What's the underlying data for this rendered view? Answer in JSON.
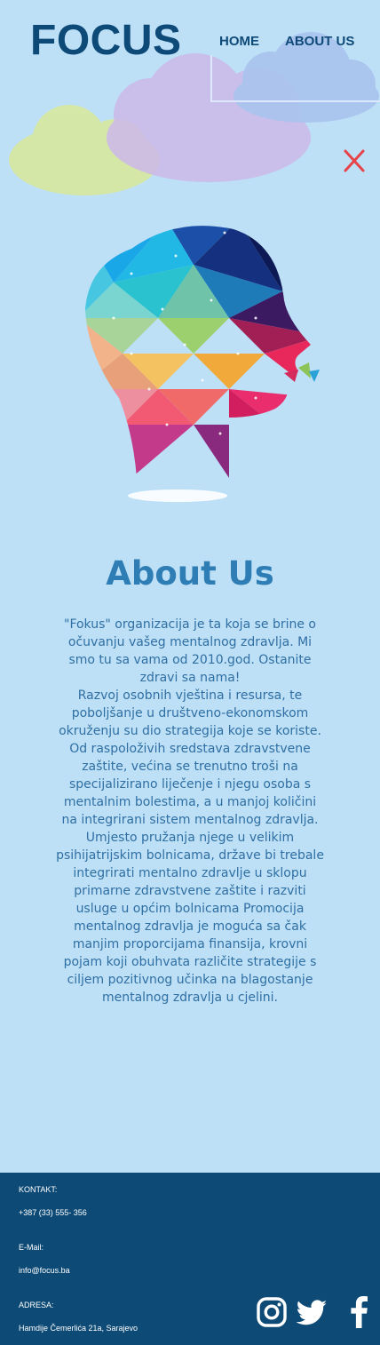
{
  "header": {
    "logo": "FOCUS",
    "nav": [
      {
        "label": "HOME"
      },
      {
        "label": "ABOUT US"
      }
    ],
    "close_icon": "close-icon"
  },
  "about": {
    "title": "About Us",
    "paragraphs": [
      "\"Fokus\" organizacija je ta koja se brine o očuvanju vašeg mentalnog zdravlja. Mi smo tu sa vama od 2010.god. Ostanite zdravi sa nama!",
      "Razvoj osobnih vještina i resursa, te poboljšanje u društveno-ekonomskom okruženju su dio strategija koje se koriste. Od raspoloživih sredstava zdravstvene zaštite, većina se trenutno troši na specijalizirano liječenje i njegu osoba s mentalnim bolestima, a u manjoj količini na integrirani sistem mentalnog zdravlja. Umjesto pružanja njege u velikim psihijatrijskim bolnicama, države bi trebale integrirati mentalno zdravlje u sklopu primarne zdravstvene zaštite i razviti usluge u općim bolnicama Promocija mentalnog zdravlja je moguća sa čak manjim proporcijama finansija, krovni pojam koji obuhvata različite strategije s ciljem pozitivnog učinka na blagostanje mentalnog zdravlja u cjelini."
    ]
  },
  "footer": {
    "contact_label": "KONTAKT:",
    "phone": "+387 (33) 555- 356",
    "email_label": "E-Mail:",
    "email": "info@focus.ba",
    "address_label": "ADRESA:",
    "address": "Hamdije Čemerlića 21a, Sarajevo",
    "social": [
      "instagram-icon",
      "twitter-icon",
      "facebook-icon"
    ]
  },
  "colors": {
    "background": "#bde0f7",
    "brand": "#0e4a78",
    "accent": "#2f7db5",
    "footer": "#0d4a75",
    "close": "#e8434a"
  }
}
